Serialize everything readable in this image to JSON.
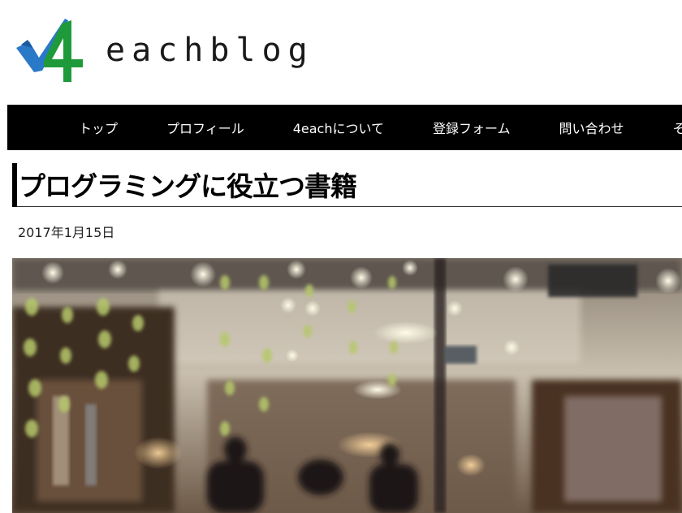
{
  "site": {
    "name": "eachblog"
  },
  "nav": {
    "items": [
      "トップ",
      "プロフィール",
      "4eachについて",
      "登録フォーム",
      "問い合わせ",
      "そ"
    ]
  },
  "post": {
    "title": "プログラミングに役立つ書籍",
    "date": "2017年1月15日"
  },
  "colors": {
    "nav_bg": "#000000",
    "logo_blue": "#2a78c8",
    "logo_green": "#1f9a3a"
  }
}
